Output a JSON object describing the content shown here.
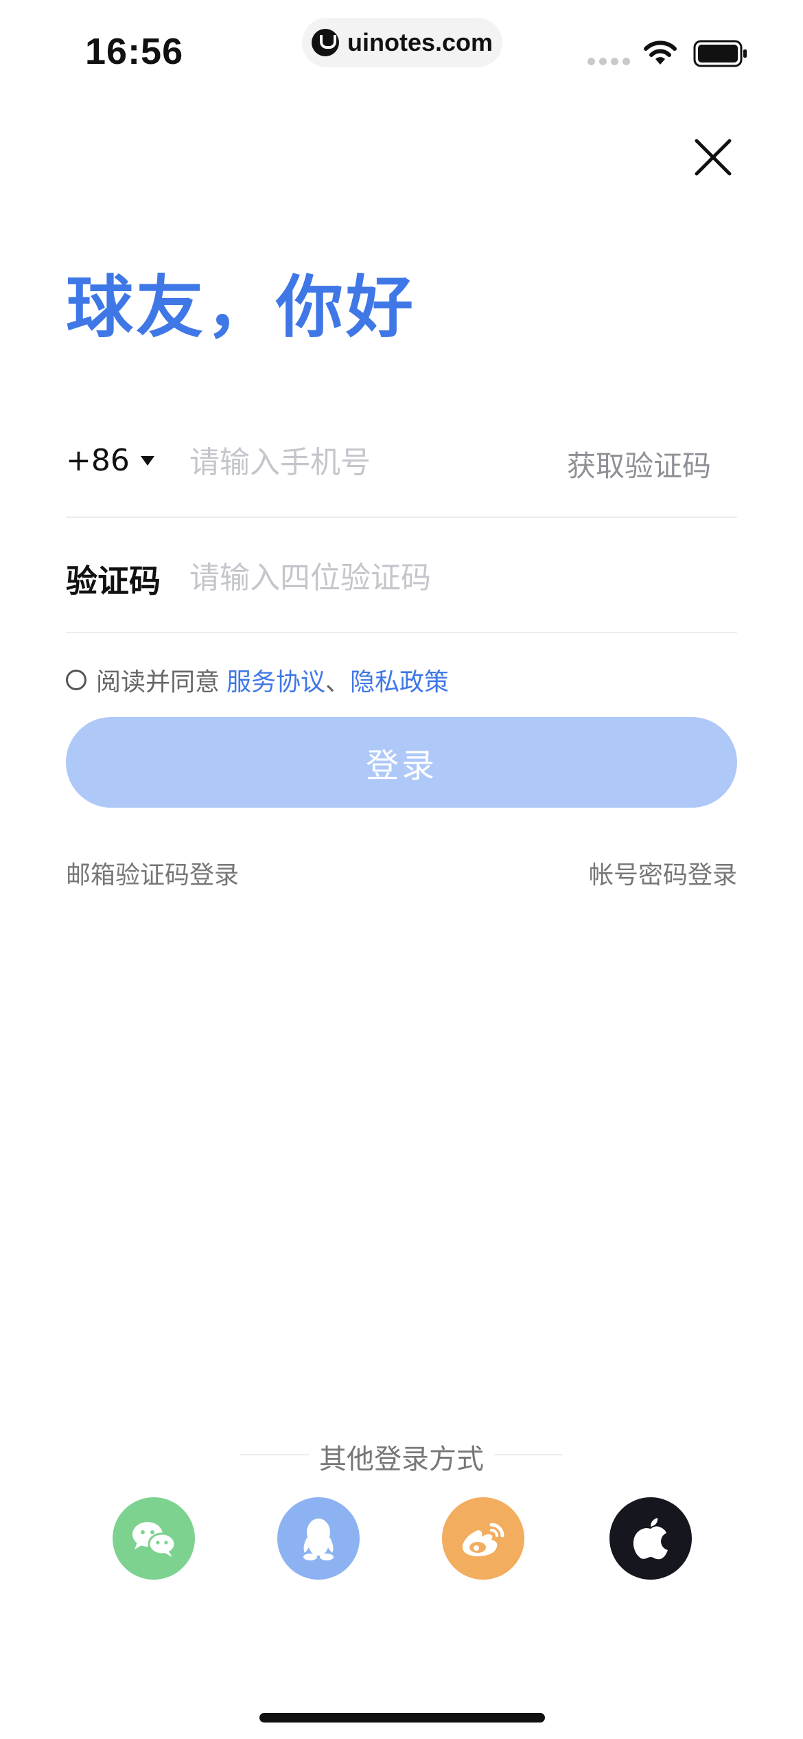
{
  "status_bar": {
    "time": "16:56",
    "url": "uinotes.com"
  },
  "header": {
    "close_icon": "close-icon"
  },
  "greeting": "球友，你好",
  "phone_row": {
    "country_code": "+86",
    "placeholder": "请输入手机号",
    "get_code_label": "获取验证码"
  },
  "code_row": {
    "label": "验证码",
    "placeholder": "请输入四位验证码"
  },
  "agreement": {
    "prefix": "阅读并同意",
    "terms_link": "服务协议",
    "separator": "、",
    "privacy_link": "隐私政策"
  },
  "login_button_label": "登录",
  "alt_logins": {
    "email": "邮箱验证码登录",
    "account": "帐号密码登录"
  },
  "other_login": {
    "title": "其他登录方式",
    "icons": [
      "wechat-icon",
      "qq-icon",
      "weibo-icon",
      "apple-icon"
    ]
  },
  "colors": {
    "accent": "#3f78e6",
    "button_disabled": "#aec8f8",
    "wechat": "#7dd28f",
    "qq": "#8cb2f2",
    "weibo": "#f2ad5e",
    "apple": "#16161f"
  }
}
